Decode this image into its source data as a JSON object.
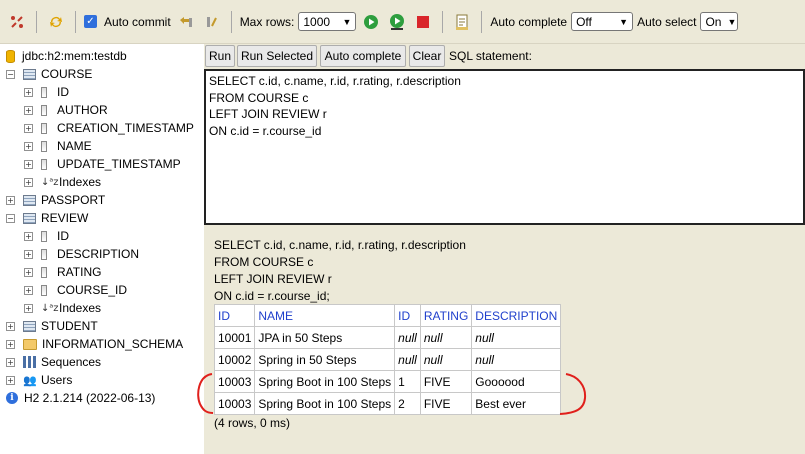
{
  "toolbar": {
    "auto_commit_label": "Auto commit",
    "max_rows_label": "Max rows:",
    "max_rows_value": "1000",
    "auto_complete_label": "Auto complete",
    "auto_complete_value": "Off",
    "auto_select_label": "Auto select",
    "auto_select_value": "On"
  },
  "tree": {
    "connection": "jdbc:h2:mem:testdb",
    "course": "COURSE",
    "course_cols": [
      "ID",
      "AUTHOR",
      "CREATION_TIMESTAMP",
      "NAME",
      "UPDATE_TIMESTAMP"
    ],
    "indexes": "Indexes",
    "passport": "PASSPORT",
    "review": "REVIEW",
    "review_cols": [
      "ID",
      "DESCRIPTION",
      "RATING",
      "COURSE_ID"
    ],
    "student": "STUDENT",
    "info_schema": "INFORMATION_SCHEMA",
    "sequences": "Sequences",
    "users": "Users",
    "version": "H2 2.1.214 (2022-06-13)"
  },
  "buttons": {
    "run": "Run",
    "run_selected": "Run Selected",
    "auto_complete": "Auto complete",
    "clear": "Clear",
    "sql_statement": "SQL statement:"
  },
  "editor_lines": [
    "SELECT c.id, c.name, r.id, r.rating, r.description",
    "FROM COURSE c",
    "LEFT JOIN REVIEW r",
    "ON c.id = r.course_id"
  ],
  "result": {
    "echo_lines": [
      "SELECT c.id, c.name, r.id, r.rating, r.description",
      "FROM COURSE c",
      "LEFT JOIN REVIEW r",
      "ON c.id = r.course_id;"
    ],
    "columns": [
      "ID",
      "NAME",
      "ID",
      "RATING",
      "DESCRIPTION"
    ],
    "rows": [
      [
        "10001",
        "JPA in 50 Steps",
        "null",
        "null",
        "null"
      ],
      [
        "10002",
        "Spring in 50 Steps",
        "null",
        "null",
        "null"
      ],
      [
        "10003",
        "Spring Boot in 100 Steps",
        "1",
        "FIVE",
        "Goooood"
      ],
      [
        "10003",
        "Spring Boot in 100 Steps",
        "2",
        "FIVE",
        "Best ever"
      ]
    ],
    "status": "(4 rows, 0 ms)"
  },
  "colors": {
    "toolbar_bg": "#ece9d8",
    "header_text": "#1f3fcc",
    "annotation": "#e0201c"
  }
}
